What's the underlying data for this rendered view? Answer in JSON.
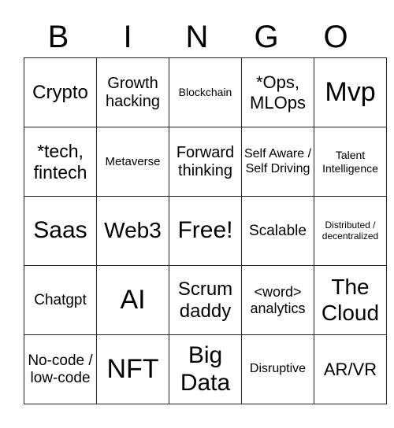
{
  "header": [
    "B",
    "I",
    "N",
    "G",
    "O"
  ],
  "cells": [
    [
      {
        "text": "Crypto",
        "size": 24
      },
      {
        "text": "Growth hacking",
        "size": 20
      },
      {
        "text": "Blockchain",
        "size": 14
      },
      {
        "text": "*Ops, MLOps",
        "size": 22
      },
      {
        "text": "Mvp",
        "size": 34
      }
    ],
    [
      {
        "text": "*tech, fintech",
        "size": 23
      },
      {
        "text": "Metaverse",
        "size": 15
      },
      {
        "text": "Forward thinking",
        "size": 20
      },
      {
        "text": "Self Aware / Self Driving",
        "size": 16
      },
      {
        "text": "Talent Intelligence",
        "size": 14
      }
    ],
    [
      {
        "text": "Saas",
        "size": 30
      },
      {
        "text": "Web3",
        "size": 28
      },
      {
        "text": "Free!",
        "size": 30
      },
      {
        "text": "Scalable",
        "size": 19
      },
      {
        "text": "Distributed / decentralized",
        "size": 12
      }
    ],
    [
      {
        "text": "Chatgpt",
        "size": 19
      },
      {
        "text": "AI",
        "size": 34
      },
      {
        "text": "Scrum daddy",
        "size": 24
      },
      {
        "text": "<word> analytics",
        "size": 18
      },
      {
        "text": "The Cloud",
        "size": 28
      }
    ],
    [
      {
        "text": "No-code / low-code",
        "size": 19
      },
      {
        "text": "NFT",
        "size": 34
      },
      {
        "text": "Big Data",
        "size": 30
      },
      {
        "text": "Disruptive",
        "size": 16
      },
      {
        "text": "AR/VR",
        "size": 22
      }
    ]
  ]
}
